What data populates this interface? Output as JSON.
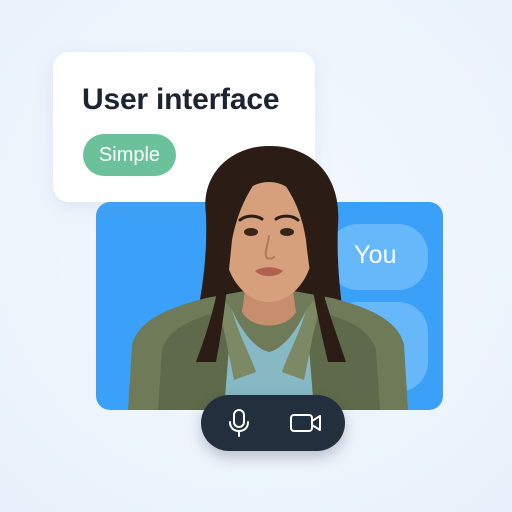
{
  "card": {
    "title": "User interface",
    "badge": "Simple"
  },
  "call": {
    "you_label": "You"
  },
  "controls": {
    "items": [
      {
        "icon": "microphone-icon"
      },
      {
        "icon": "video-camera-icon"
      }
    ]
  },
  "colors": {
    "page_background": "#eef5fc",
    "call_panel": "#3ba1f8",
    "bubble": "#66b8fa",
    "badge": "#6bc29a",
    "title_text": "#1b2433",
    "control_bar": "#22303d"
  }
}
